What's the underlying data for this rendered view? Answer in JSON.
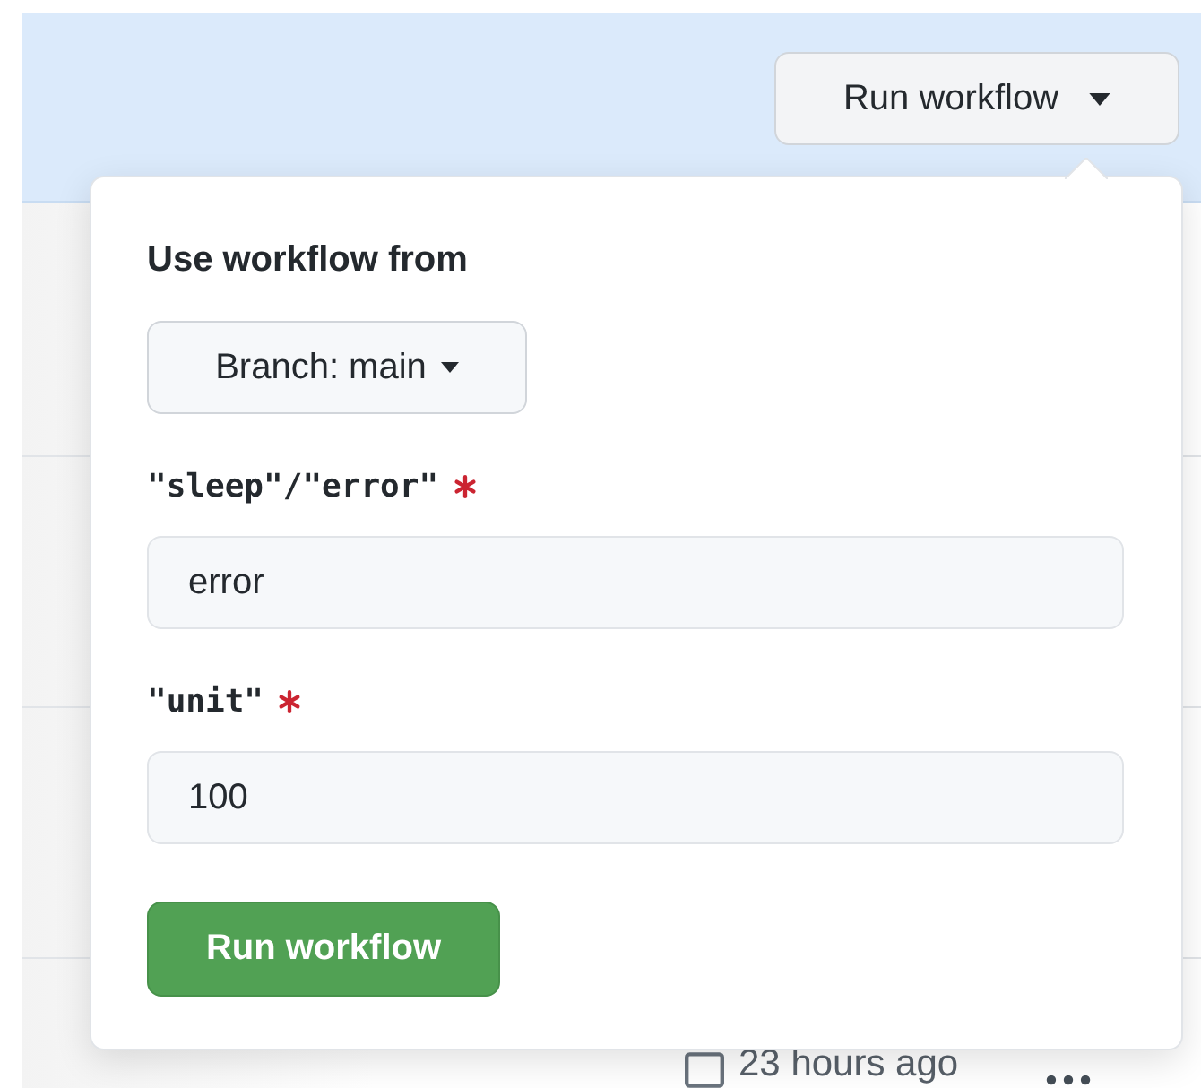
{
  "header": {
    "button": {
      "label": "Run workflow"
    }
  },
  "background_row": {
    "time": "23 hours ago"
  },
  "popover": {
    "title": "Use workflow from",
    "branch_button": {
      "label": "Branch: main"
    },
    "inputs": [
      {
        "label": "\"sleep\"/\"error\"",
        "required": true,
        "value": "error"
      },
      {
        "label": "\"unit\"",
        "required": true,
        "value": "100"
      }
    ],
    "submit": {
      "label": "Run workflow"
    }
  }
}
